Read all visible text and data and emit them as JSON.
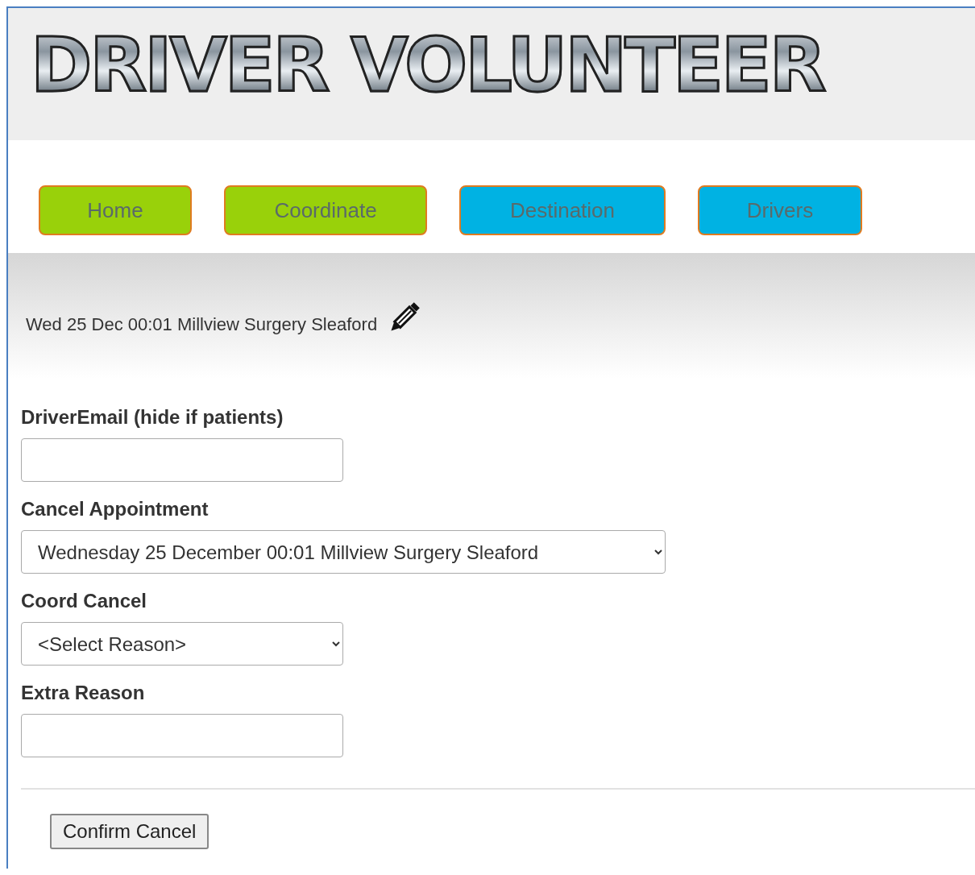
{
  "header": {
    "logo": "DRIVER VOLUNTEER"
  },
  "nav": [
    {
      "label": "Home",
      "color": "#99d10a"
    },
    {
      "label": "Coordinate",
      "color": "#99d10a"
    },
    {
      "label": "Destination",
      "color": "#00b2e3"
    },
    {
      "label": "Drivers",
      "color": "#00b2e3"
    }
  ],
  "appointment": {
    "summary": "Wed 25 Dec 00:01 Millview Surgery Sleaford"
  },
  "form": {
    "fields": [
      {
        "kind": "text",
        "label": "DriverEmail (hide if patients)"
      },
      {
        "kind": "select",
        "label": "Cancel Appointment",
        "value": "Wednesday 25 December 00:01 Millview Surgery Sleaford"
      },
      {
        "kind": "select",
        "label": "Coord Cancel",
        "value": "<Select Reason>"
      },
      {
        "kind": "text",
        "label": "Extra Reason"
      }
    ],
    "submit": "Confirm Cancel"
  }
}
